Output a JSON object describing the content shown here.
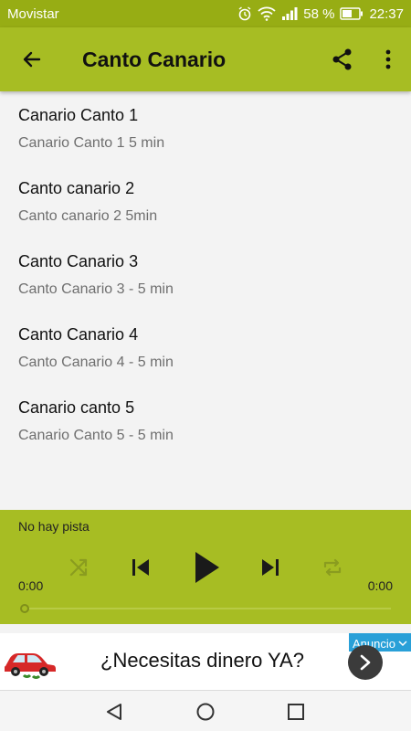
{
  "status_bar": {
    "carrier": "Movistar",
    "battery_percent": "58 %",
    "time": "22:37",
    "icons": [
      "alarm-icon",
      "wifi-icon",
      "signal-icon",
      "battery-icon"
    ]
  },
  "toolbar": {
    "title": "Canto Canario",
    "back_icon": "arrow-left-icon",
    "share_icon": "share-icon",
    "menu_icon": "more-vertical-icon"
  },
  "tracks": [
    {
      "title": "Canario Canto 1",
      "subtitle": "Canario Canto 1 5 min"
    },
    {
      "title": "Canto canario 2",
      "subtitle": "Canto canario 2 5min"
    },
    {
      "title": "Canto Canario 3",
      "subtitle": "Canto Canario 3 - 5 min"
    },
    {
      "title": "Canto Canario 4",
      "subtitle": "Canto Canario 4 - 5 min"
    },
    {
      "title": "Canario canto 5",
      "subtitle": "Canario Canto 5 - 5 min"
    }
  ],
  "player": {
    "track_label": "No hay pista",
    "elapsed": "0:00",
    "duration": "0:00",
    "progress": 0,
    "controls": [
      "shuffle-icon",
      "previous-icon",
      "play-icon",
      "next-icon",
      "repeat-icon"
    ]
  },
  "ad": {
    "headline": "¿Necesitas dinero YA?",
    "badge": "Anuncio"
  },
  "colors": {
    "accent": "#a7bd23",
    "status_bar": "#97ad14",
    "ad_badge": "#29a0d8"
  }
}
